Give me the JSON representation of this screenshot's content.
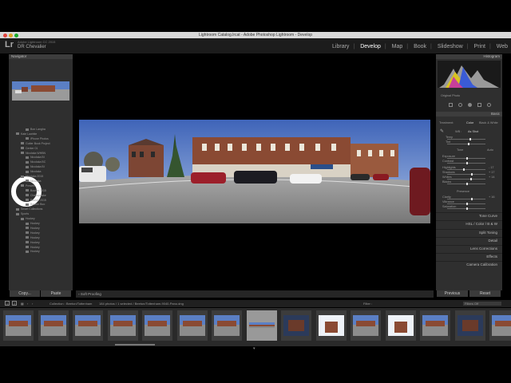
{
  "window": {
    "title": "Lightroom Catalog.lrcat - Adobe Photoshop Lightroom - Develop"
  },
  "identity": {
    "logo": "Lr",
    "version": "Adobe Lightroom CC 2015",
    "user": "DR Chevalier"
  },
  "modules": [
    {
      "label": "Library",
      "active": false
    },
    {
      "label": "Develop",
      "active": true
    },
    {
      "label": "Map",
      "active": false
    },
    {
      "label": "Book",
      "active": false
    },
    {
      "label": "Slideshow",
      "active": false
    },
    {
      "label": "Print",
      "active": false
    },
    {
      "label": "Web",
      "active": false
    }
  ],
  "left_panel": {
    "navigator_title": "Navigator",
    "tree": [
      "Bon Langha",
      "Kate Lawhite",
      "iPhone Photos",
      "Gutter Book Project",
      "Center 01",
      "Nicolaka WHBN",
      "Nicolaka BI",
      "Nicolaka BC",
      "Nicolaka BI",
      "Nicolaka",
      "Nicolaka 2015",
      "Nicolaka",
      "Presets",
      "Bouton 2015",
      "Chesapeake",
      "Bouton 2015",
      "Bouton Boo",
      "Smart Collections",
      "Sports",
      "Hockey",
      "Hockey",
      "Hockey",
      "Hockey",
      "Hockey",
      "Hockey",
      "Hockey",
      "Hockey"
    ],
    "copy_label": "Copy...",
    "paste_label": "Paste"
  },
  "right_panel": {
    "histogram_title": "Histogram",
    "original_photo_label": "Original Photo",
    "basic_title": "Basic",
    "treatment_label": "Treatment:",
    "treatment_color": "Color",
    "treatment_bw": "Black & White",
    "wb_label": "WB :",
    "wb_value": "As Shot",
    "temp_label": "Temp",
    "tint_label": "Tint",
    "tone_label": "Tone",
    "auto_label": "Auto",
    "exposure_label": "Exposure",
    "contrast_label": "Contrast",
    "highlights_label": "Highlights",
    "shadows_label": "Shadows",
    "whites_label": "Whites",
    "blacks_label": "Blacks",
    "presence_label": "Presence",
    "clarity_label": "Clarity",
    "vibrance_label": "Vibrance",
    "saturation_label": "Saturation",
    "values": {
      "highlights": "- 17",
      "shadows": "+ 17",
      "whites": "+ 14",
      "clarity": "+ 16"
    },
    "sections": [
      "Tone Curve",
      "HSL / Color / B & W",
      "Split Toning",
      "Detail",
      "Lens Corrections",
      "Effects",
      "Camera Calibration"
    ],
    "previous_label": "Previous",
    "reset_label": "Reset"
  },
  "toolbar": {
    "soft_proofing": "Soft Proofing"
  },
  "filmstrip_bar": {
    "page_1": "1",
    "page_2": "2",
    "collection": "Collection : Beeton/Tottenham",
    "count": "184 photos / 1 selected / Beeton/Tottenham-9040-Pano.dng",
    "filter_label": "Filter :",
    "filter_value": "Filters Off"
  },
  "colors": {
    "sky": "#5b7fc4",
    "brick": "#8a4a33",
    "road": "#8c8c8c",
    "panel": "#2f2f2f",
    "accent": "#ffffff"
  }
}
